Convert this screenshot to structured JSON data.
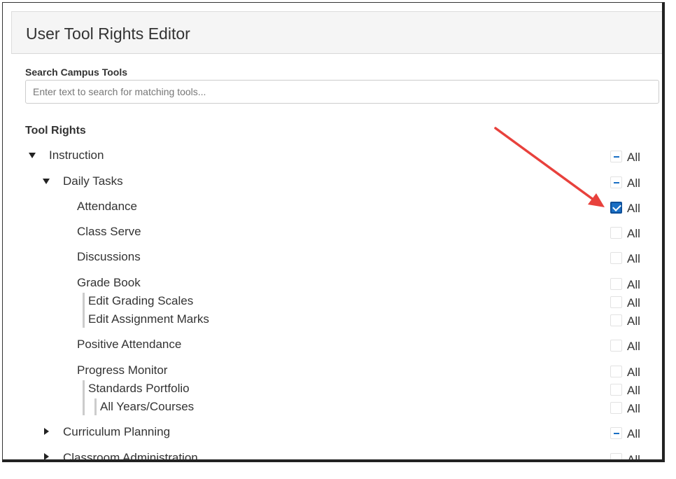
{
  "header": {
    "title": "User Tool Rights Editor"
  },
  "search": {
    "label": "Search Campus Tools",
    "placeholder": "Enter text to search for matching tools...",
    "value": ""
  },
  "tool_rights": {
    "heading": "Tool Rights",
    "all_label": "All",
    "items": {
      "instruction": {
        "label": "Instruction",
        "state": "partial"
      },
      "daily_tasks": {
        "label": "Daily Tasks",
        "state": "partial"
      },
      "attendance": {
        "label": "Attendance",
        "state": "checked"
      },
      "class_serve": {
        "label": "Class Serve",
        "state": "unchecked"
      },
      "discussions": {
        "label": "Discussions",
        "state": "unchecked"
      },
      "grade_book": {
        "label": "Grade Book",
        "state": "unchecked"
      },
      "edit_grading_scales": {
        "label": "Edit Grading Scales",
        "state": "unchecked"
      },
      "edit_assignment_marks": {
        "label": "Edit Assignment Marks",
        "state": "unchecked"
      },
      "positive_attendance": {
        "label": "Positive Attendance",
        "state": "unchecked"
      },
      "progress_monitor": {
        "label": "Progress Monitor",
        "state": "unchecked"
      },
      "standards_portfolio": {
        "label": "Standards Portfolio",
        "state": "unchecked"
      },
      "all_years_courses": {
        "label": "All Years/Courses",
        "state": "unchecked"
      },
      "curriculum_planning": {
        "label": "Curriculum Planning",
        "state": "partial"
      },
      "classroom_administration": {
        "label": "Classroom Administration",
        "state": "unchecked"
      }
    }
  },
  "annotation": {
    "arrow_color": "#e8413c",
    "checkbox_accent": "#1a6fc4"
  }
}
